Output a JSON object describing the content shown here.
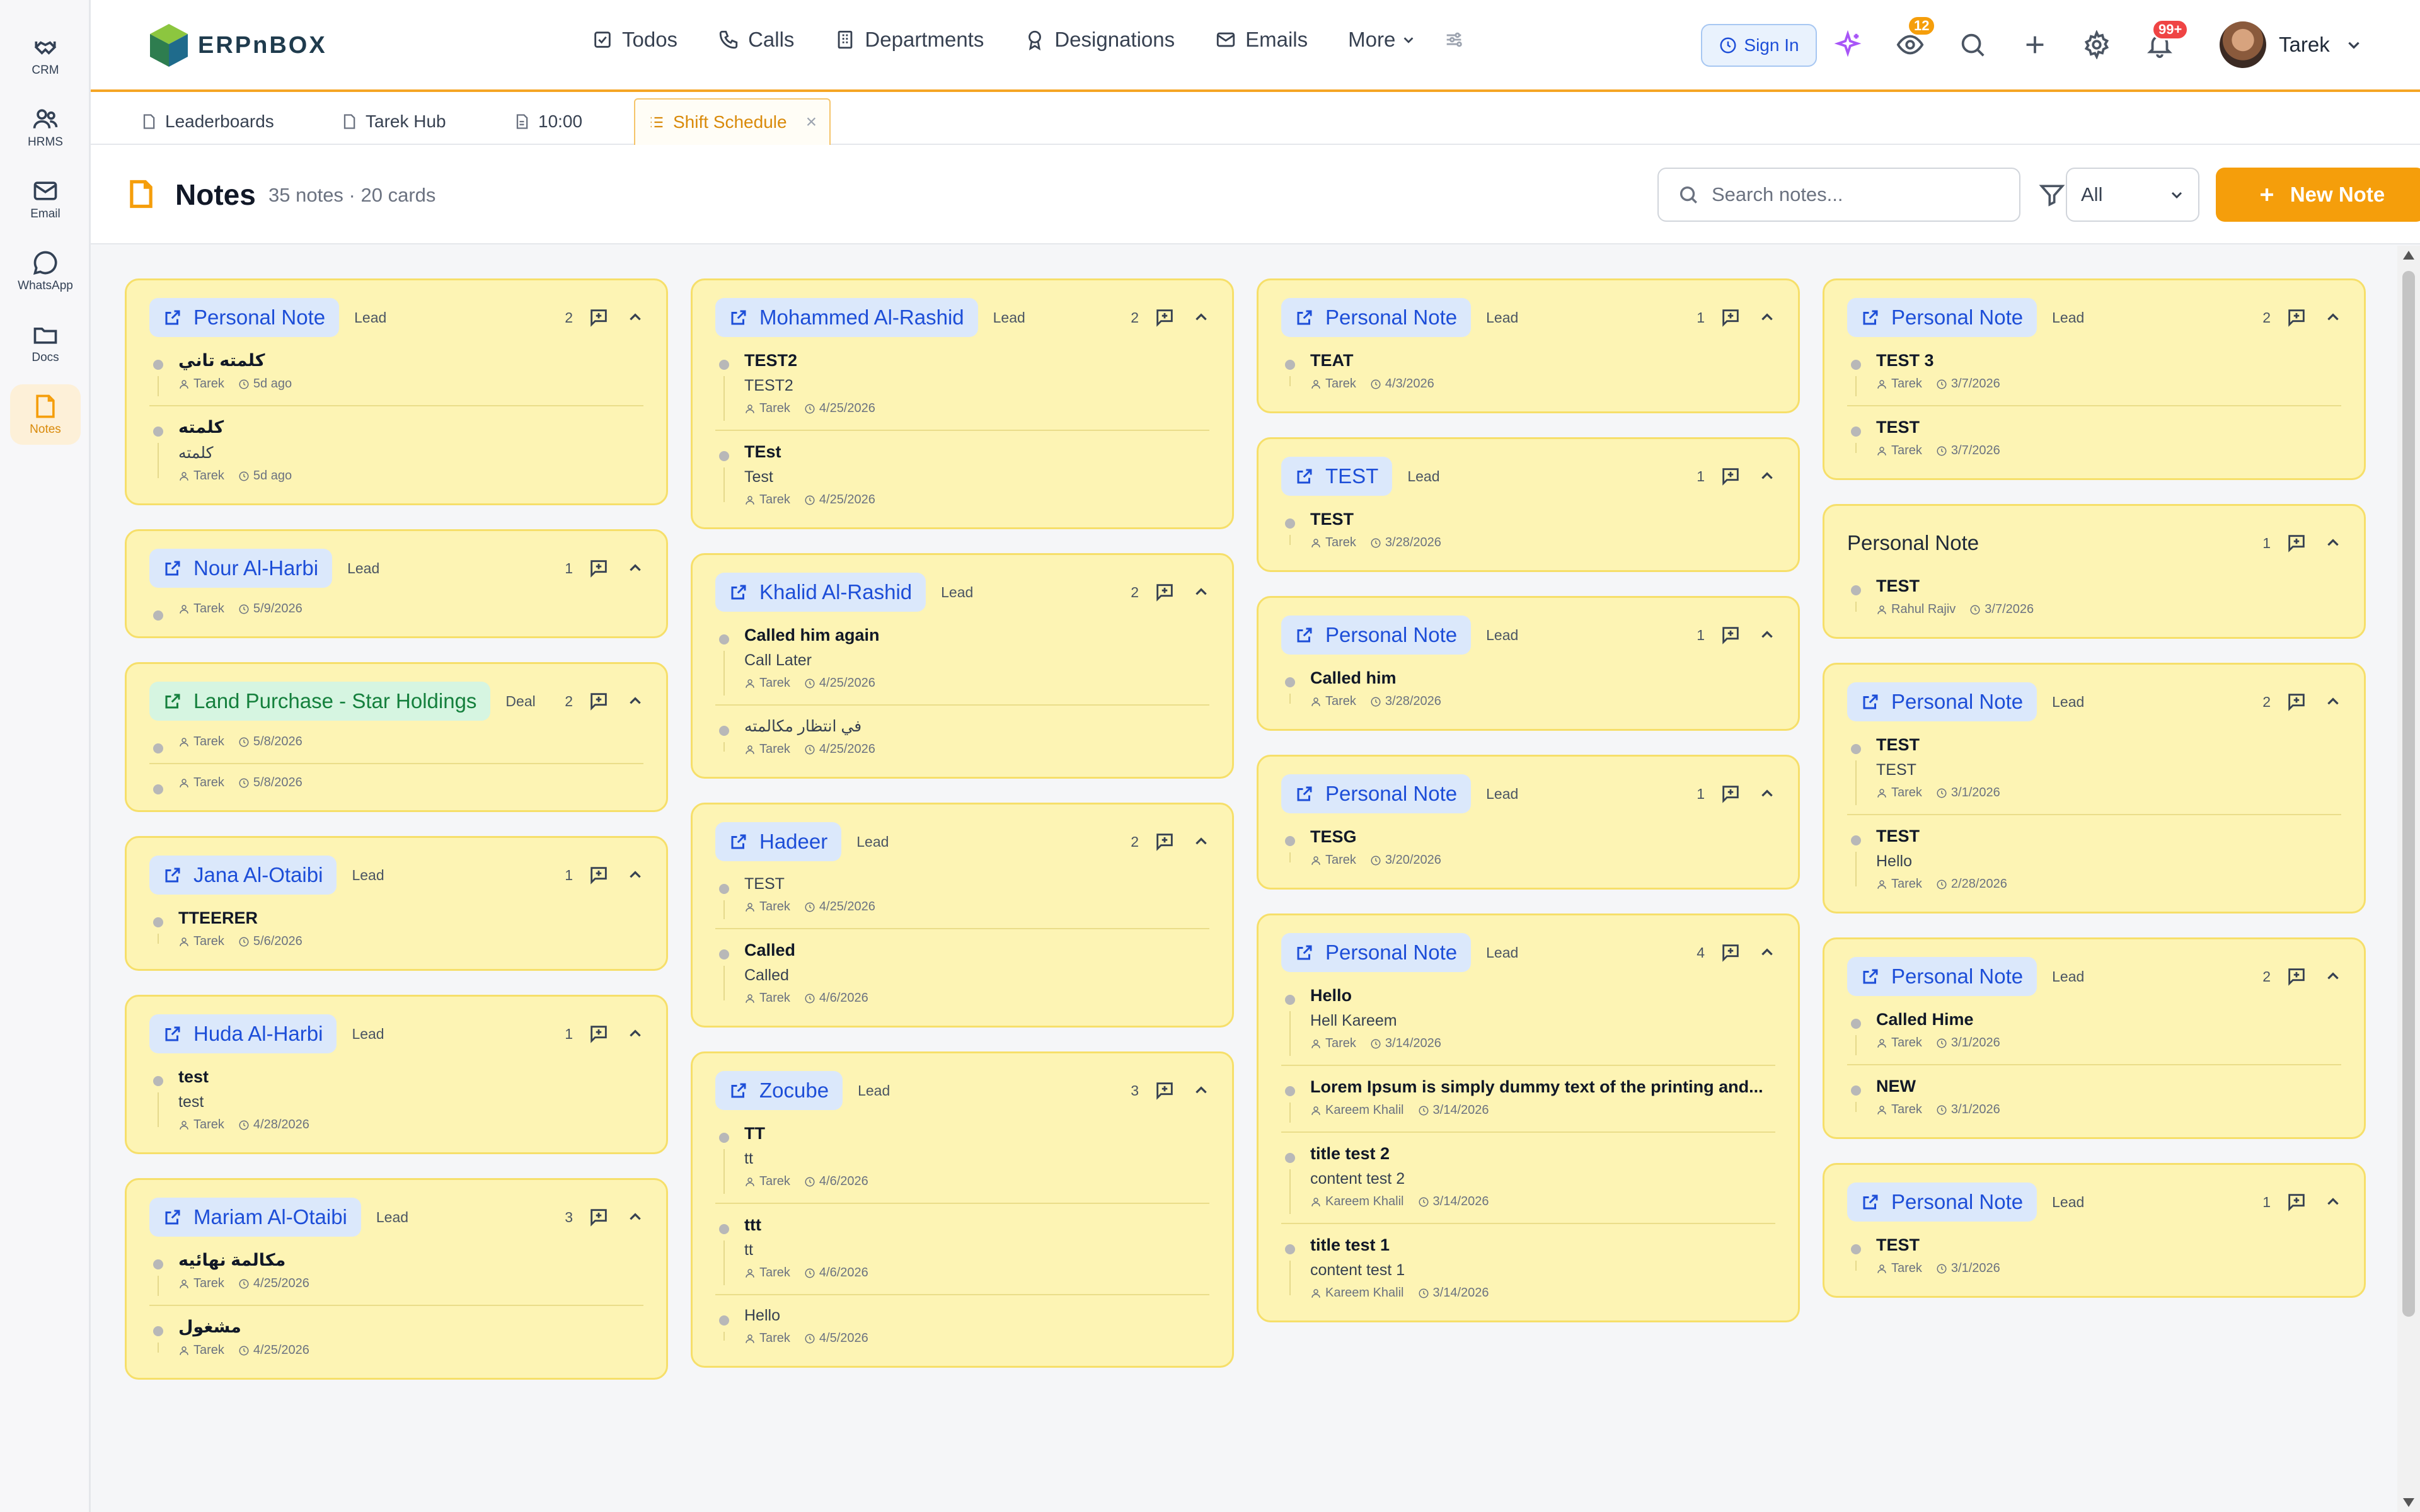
{
  "rail": [
    {
      "key": "crm",
      "label": "CRM",
      "icon": "handshake-icon"
    },
    {
      "key": "hrms",
      "label": "HRMS",
      "icon": "users-icon"
    },
    {
      "key": "email",
      "label": "Email",
      "icon": "mail-icon"
    },
    {
      "key": "whatsapp",
      "label": "WhatsApp",
      "icon": "chat-bubble-icon"
    },
    {
      "key": "docs",
      "label": "Docs",
      "icon": "folder-icon"
    },
    {
      "key": "notes",
      "label": "Notes",
      "icon": "note-icon",
      "active": true
    }
  ],
  "header": {
    "logo_text": "ERPnBOX",
    "nav": [
      "Todos",
      "Calls",
      "Departments",
      "Designations",
      "Emails"
    ],
    "more_label": "More",
    "signin_label": "Sign In",
    "eye_badge": "12",
    "bell_badge": "99+",
    "user_name": "Tarek"
  },
  "tabs": [
    {
      "label": "Leaderboards"
    },
    {
      "label": "Tarek Hub"
    },
    {
      "label": "10:00"
    },
    {
      "label": "Shift Schedule",
      "active": true
    }
  ],
  "page": {
    "title": "Notes",
    "meta": "35 notes · 20 cards",
    "search_placeholder": "Search notes...",
    "filter_value": "All",
    "new_note_label": "New Note"
  },
  "colors": {
    "accent": "#f59e0b",
    "card_bg": "#fdf4b4",
    "card_border": "#f6df6a",
    "lead_chip": "#dbe8fb",
    "deal_chip": "#d6f5e1"
  },
  "columns": [
    [
      {
        "title": "Personal Note",
        "type": "Lead",
        "count": "2",
        "notes": [
          {
            "title": "كلمته تاني",
            "body": "",
            "author": "Tarek",
            "date": "5d ago"
          },
          {
            "title": "كلمته",
            "body": "كلمته",
            "author": "Tarek",
            "date": "5d ago"
          }
        ]
      },
      {
        "title": "Nour Al-Harbi",
        "type": "Lead",
        "count": "1",
        "notes": [
          {
            "title": "",
            "body": "",
            "author": "Tarek",
            "date": "5/9/2026"
          }
        ]
      },
      {
        "title": "Land Purchase - Star Holdings",
        "type": "Deal",
        "count": "2",
        "deal": true,
        "notes": [
          {
            "title": "",
            "body": "",
            "author": "Tarek",
            "date": "5/8/2026"
          },
          {
            "title": "",
            "body": "",
            "author": "Tarek",
            "date": "5/8/2026"
          }
        ]
      },
      {
        "title": "Jana Al-Otaibi",
        "type": "Lead",
        "count": "1",
        "notes": [
          {
            "title": "TTEERER",
            "body": "",
            "author": "Tarek",
            "date": "5/6/2026"
          }
        ]
      },
      {
        "title": "Huda Al-Harbi",
        "type": "Lead",
        "count": "1",
        "notes": [
          {
            "title": "test",
            "body": "test",
            "author": "Tarek",
            "date": "4/28/2026"
          }
        ]
      },
      {
        "title": "Mariam Al-Otaibi",
        "type": "Lead",
        "count": "3",
        "notes": [
          {
            "title": "مكالمة نهائيه",
            "body": "",
            "author": "Tarek",
            "date": "4/25/2026"
          },
          {
            "title": "مشغول",
            "body": "",
            "author": "Tarek",
            "date": "4/25/2026"
          }
        ]
      }
    ],
    [
      {
        "title": "Mohammed Al-Rashid",
        "type": "Lead",
        "count": "2",
        "notes": [
          {
            "title": "TEST2",
            "body": "TEST2",
            "author": "Tarek",
            "date": "4/25/2026"
          },
          {
            "title": "TEst",
            "body": "Test",
            "author": "Tarek",
            "date": "4/25/2026"
          }
        ]
      },
      {
        "title": "Khalid Al-Rashid",
        "type": "Lead",
        "count": "2",
        "notes": [
          {
            "title": "Called him again",
            "body": "Call Later",
            "author": "Tarek",
            "date": "4/25/2026"
          },
          {
            "title": "",
            "body": "في انتظار مكالمته",
            "author": "Tarek",
            "date": "4/25/2026"
          }
        ]
      },
      {
        "title": "Hadeer",
        "type": "Lead",
        "count": "2",
        "notes": [
          {
            "title": "",
            "body": "TEST",
            "author": "Tarek",
            "date": "4/25/2026"
          },
          {
            "title": "Called",
            "body": "Called",
            "author": "Tarek",
            "date": "4/6/2026"
          }
        ]
      },
      {
        "title": "Zocube",
        "type": "Lead",
        "count": "3",
        "notes": [
          {
            "title": "TT",
            "body": "tt",
            "author": "Tarek",
            "date": "4/6/2026"
          },
          {
            "title": "ttt",
            "body": "tt",
            "author": "Tarek",
            "date": "4/6/2026"
          },
          {
            "title": "",
            "body": "Hello",
            "author": "Tarek",
            "date": "4/5/2026"
          }
        ]
      }
    ],
    [
      {
        "title": "Personal Note",
        "type": "Lead",
        "count": "1",
        "notes": [
          {
            "title": "TEAT",
            "body": "",
            "author": "Tarek",
            "date": "4/3/2026"
          }
        ]
      },
      {
        "title": "TEST",
        "type": "Lead",
        "count": "1",
        "notes": [
          {
            "title": "TEST",
            "body": "",
            "author": "Tarek",
            "date": "3/28/2026"
          }
        ]
      },
      {
        "title": "Personal Note",
        "type": "Lead",
        "count": "1",
        "notes": [
          {
            "title": "Called him",
            "body": "",
            "author": "Tarek",
            "date": "3/28/2026"
          }
        ]
      },
      {
        "title": "Personal Note",
        "type": "Lead",
        "count": "1",
        "notes": [
          {
            "title": "TESG",
            "body": "",
            "author": "Tarek",
            "date": "3/20/2026"
          }
        ]
      },
      {
        "title": "Personal Note",
        "type": "Lead",
        "count": "4",
        "notes": [
          {
            "title": "Hello",
            "body": "Hell Kareem",
            "author": "Tarek",
            "date": "3/14/2026"
          },
          {
            "title": "Lorem Ipsum is simply dummy text of the printing and...",
            "body": "",
            "author": "Kareem Khalil",
            "date": "3/14/2026"
          },
          {
            "title": "title test 2",
            "body": "content test 2",
            "author": "Kareem Khalil",
            "date": "3/14/2026"
          },
          {
            "title": "title test 1",
            "body": "content test 1",
            "author": "Kareem Khalil",
            "date": "3/14/2026"
          }
        ]
      }
    ],
    [
      {
        "title": "Personal Note",
        "type": "Lead",
        "count": "2",
        "notes": [
          {
            "title": "TEST 3",
            "body": "",
            "author": "Tarek",
            "date": "3/7/2026"
          },
          {
            "title": "TEST",
            "body": "",
            "author": "Tarek",
            "date": "3/7/2026"
          }
        ]
      },
      {
        "title": "Personal Note",
        "type": "",
        "count": "1",
        "plain": true,
        "notes": [
          {
            "title": "TEST",
            "body": "",
            "author": "Rahul Rajiv",
            "date": "3/7/2026"
          }
        ]
      },
      {
        "title": "Personal Note",
        "type": "Lead",
        "count": "2",
        "notes": [
          {
            "title": "TEST",
            "body": "TEST",
            "author": "Tarek",
            "date": "3/1/2026"
          },
          {
            "title": "TEST",
            "body": "Hello",
            "author": "Tarek",
            "date": "2/28/2026"
          }
        ]
      },
      {
        "title": "Personal Note",
        "type": "Lead",
        "count": "2",
        "notes": [
          {
            "title": "Called Hime",
            "body": "",
            "author": "Tarek",
            "date": "3/1/2026"
          },
          {
            "title": "NEW",
            "body": "",
            "author": "Tarek",
            "date": "3/1/2026"
          }
        ]
      },
      {
        "title": "Personal Note",
        "type": "Lead",
        "count": "1",
        "notes": [
          {
            "title": "TEST",
            "body": "",
            "author": "Tarek",
            "date": "3/1/2026"
          }
        ]
      }
    ]
  ]
}
